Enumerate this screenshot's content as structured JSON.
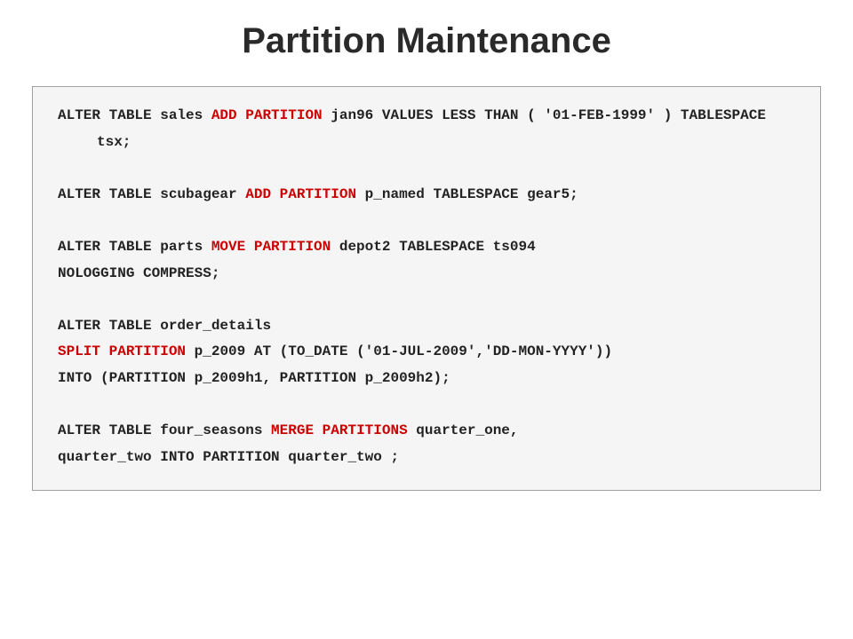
{
  "title": "Partition Maintenance",
  "code": {
    "line1a": "ALTER TABLE sales ",
    "kw1": "ADD PARTITION",
    "line1b": " jan96 VALUES LESS THAN ( '01-FEB-1999' ) TABLESPACE tsx;",
    "line2a": "ALTER TABLE scubagear ",
    "kw2": "ADD PARTITION",
    "line2b": " p_named TABLESPACE gear5;",
    "line3a": "ALTER TABLE parts ",
    "kw3": "MOVE PARTITION",
    "line3b": " depot2 TABLESPACE ts094",
    "line3c": "NOLOGGING COMPRESS;",
    "line4a": "ALTER TABLE order_details",
    "kw4": "SPLIT PARTITION",
    "line4b": " p_2009 AT (TO_DATE ('01-JUL-2009','DD-MON-YYYY'))",
    "line4c": "INTO (PARTITION p_2009h1, PARTITION p_2009h2);",
    "line5a": "ALTER TABLE four_seasons ",
    "kw5": "MERGE PARTITIONS",
    "line5b": " quarter_one,",
    "line5c": "quarter_two INTO PARTITION quarter_two ;"
  }
}
